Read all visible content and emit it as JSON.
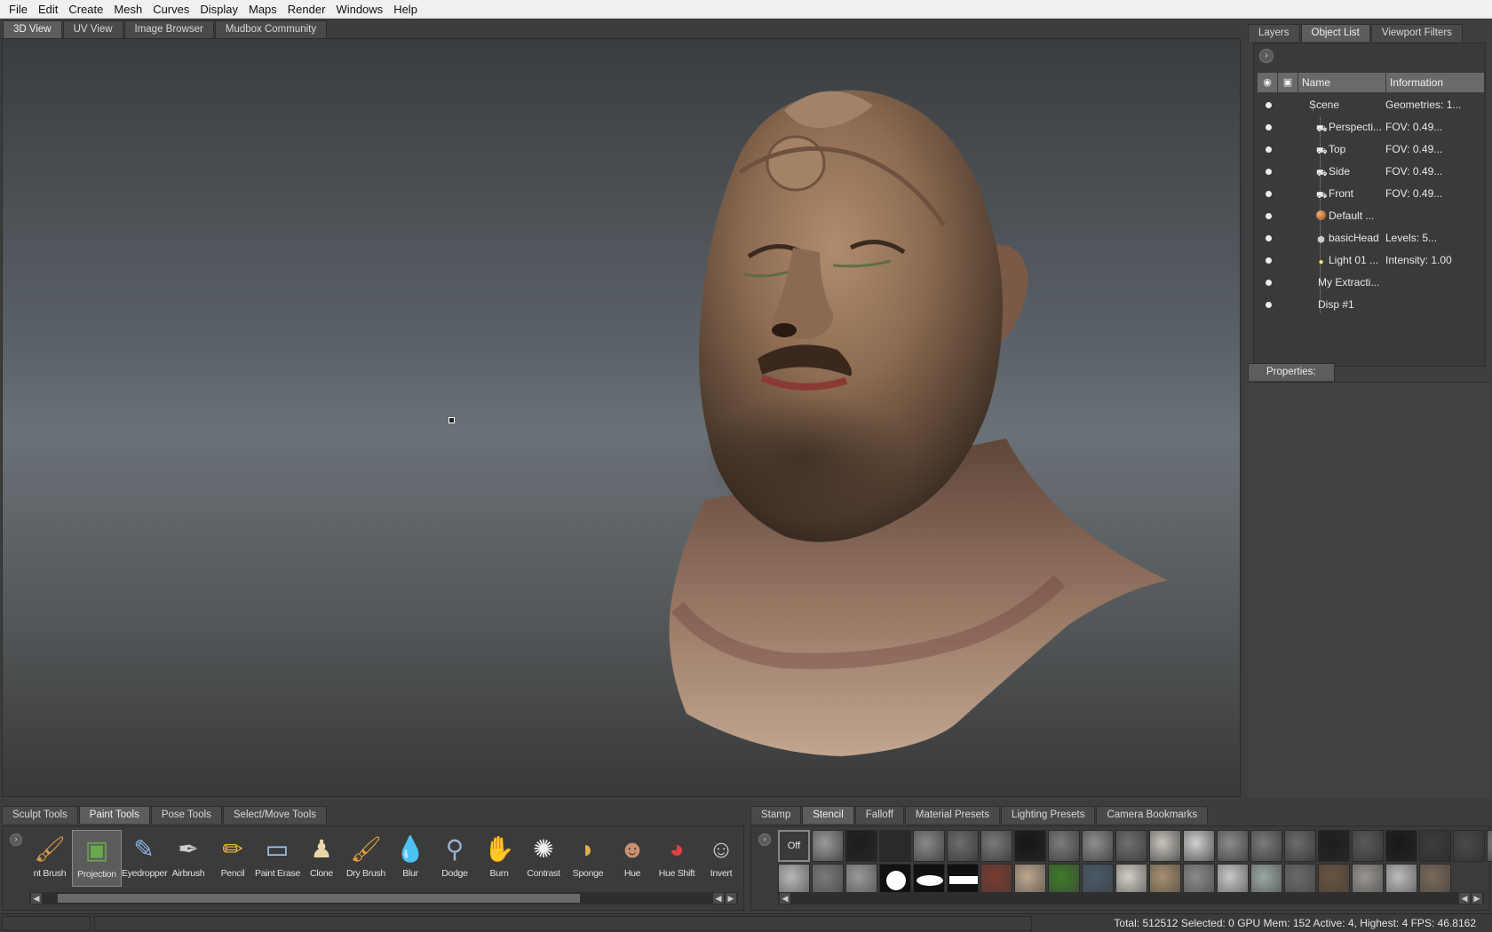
{
  "menubar": [
    "File",
    "Edit",
    "Create",
    "Mesh",
    "Curves",
    "Display",
    "Maps",
    "Render",
    "Windows",
    "Help"
  ],
  "view_tabs": [
    {
      "label": "3D View",
      "active": true
    },
    {
      "label": "UV View",
      "active": false
    },
    {
      "label": "Image Browser",
      "active": false
    },
    {
      "label": "Mudbox Community",
      "active": false
    }
  ],
  "right_tabs": [
    {
      "label": "Layers",
      "active": false
    },
    {
      "label": "Object List",
      "active": true
    },
    {
      "label": "Viewport Filters",
      "active": false
    }
  ],
  "object_list": {
    "headers": {
      "name": "Name",
      "info": "Information"
    },
    "rows": [
      {
        "name": "Scene",
        "info": "Geometries: 1...",
        "icon": "",
        "indent": 0
      },
      {
        "name": "Perspecti...",
        "info": "FOV: 0.49...",
        "icon": "camera-icon",
        "indent": 1
      },
      {
        "name": "Top",
        "info": "FOV: 0.49...",
        "icon": "camera-icon",
        "indent": 1
      },
      {
        "name": "Side",
        "info": "FOV: 0.49...",
        "icon": "camera-icon",
        "indent": 1
      },
      {
        "name": "Front",
        "info": "FOV: 0.49...",
        "icon": "camera-icon",
        "indent": 1
      },
      {
        "name": "Default ...",
        "info": "",
        "icon": "material-icon",
        "indent": 1
      },
      {
        "name": "basicHead",
        "info": "Levels: 5...",
        "icon": "geometry-icon",
        "indent": 1
      },
      {
        "name": "Light 01 ...",
        "info": "Intensity: 1.00",
        "icon": "light-icon",
        "indent": 1
      },
      {
        "name": "My Extracti...",
        "info": "",
        "icon": "",
        "indent": 1
      },
      {
        "name": "Disp #1",
        "info": "",
        "icon": "",
        "indent": 1
      }
    ]
  },
  "properties_tab": "Properties:",
  "tool_tabs": [
    {
      "label": "Sculpt Tools",
      "active": false
    },
    {
      "label": "Paint Tools",
      "active": true
    },
    {
      "label": "Pose Tools",
      "active": false
    },
    {
      "label": "Select/Move Tools",
      "active": false
    }
  ],
  "paint_tools": [
    {
      "label": "nt Brush",
      "icon": "paint-brush-icon",
      "selected": false
    },
    {
      "label": "Projection",
      "icon": "projection-icon",
      "selected": true
    },
    {
      "label": "Eyedropper",
      "icon": "eyedropper-icon",
      "selected": false
    },
    {
      "label": "Airbrush",
      "icon": "airbrush-icon",
      "selected": false
    },
    {
      "label": "Pencil",
      "icon": "pencil-icon",
      "selected": false
    },
    {
      "label": "Paint Erase",
      "icon": "eraser-icon",
      "selected": false
    },
    {
      "label": "Clone",
      "icon": "clone-stamp-icon",
      "selected": false
    },
    {
      "label": "Dry Brush",
      "icon": "dry-brush-icon",
      "selected": false
    },
    {
      "label": "Blur",
      "icon": "blur-drop-icon",
      "selected": false
    },
    {
      "label": "Dodge",
      "icon": "dodge-icon",
      "selected": false
    },
    {
      "label": "Burn",
      "icon": "burn-icon",
      "selected": false
    },
    {
      "label": "Contrast",
      "icon": "contrast-icon",
      "selected": false
    },
    {
      "label": "Sponge",
      "icon": "sponge-icon",
      "selected": false
    },
    {
      "label": "Hue",
      "icon": "hue-head-icon",
      "selected": false
    },
    {
      "label": "Hue Shift",
      "icon": "hue-shift-ball-icon",
      "selected": false
    },
    {
      "label": "Invert",
      "icon": "invert-head-icon",
      "selected": false
    }
  ],
  "stamp_tabs": [
    {
      "label": "Stamp",
      "active": false
    },
    {
      "label": "Stencil",
      "active": true
    },
    {
      "label": "Falloff",
      "active": false
    },
    {
      "label": "Material Presets",
      "active": false
    },
    {
      "label": "Lighting Presets",
      "active": false
    },
    {
      "label": "Camera Bookmarks",
      "active": false
    }
  ],
  "stencil_off_label": "Off",
  "stencil_swatches": {
    "row1": [
      "#9a9a9a",
      "#1d1d1d",
      "#2a2a2a",
      "#8a8a8a",
      "#6e6e6e",
      "#7a7a7a",
      "#161616",
      "#7d7d7d",
      "#8f8f8f",
      "#707070",
      "#c8c4bc",
      "#d0d0d0",
      "#8c8c8c",
      "#7a7a7a",
      "#6c6c6c",
      "#1e1e1e",
      "#5a5a5a",
      "#181818",
      "#3c3c3c",
      "#4a4a4a",
      "#8a8a8a"
    ],
    "row2": [
      "#b8b8b8",
      "#7a7a7a",
      "#9a9a9a",
      "#ffffff",
      "#ffffff",
      "#ffffff",
      "#7a3a2e",
      "#c0a890",
      "#3e7a2a",
      "#4a5a6a",
      "#d2cec6",
      "#a89070",
      "#8a8a8a",
      "#c8c8c8",
      "#9aa8a4",
      "#6a6a6a",
      "#6a5440",
      "#9a9690",
      "#bdbdbd",
      "#7a6a5a"
    ]
  },
  "status": "Total: 512512  Selected: 0 GPU Mem: 152  Active: 4, Highest: 4  FPS: 46.8162"
}
